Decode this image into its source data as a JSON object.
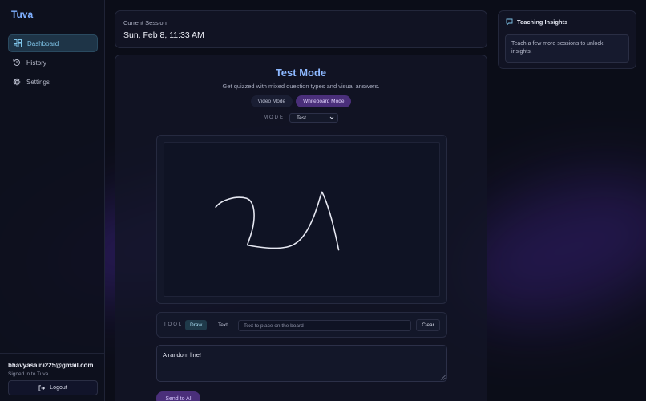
{
  "app": {
    "brand": "Tuva"
  },
  "sidebar": {
    "items": [
      {
        "label": "Dashboard",
        "icon": "dashboard-icon",
        "active": true
      },
      {
        "label": "History",
        "icon": "history-icon",
        "active": false
      },
      {
        "label": "Settings",
        "icon": "gear-icon",
        "active": false
      }
    ],
    "user": {
      "email": "bhavyasaini225@gmail.com",
      "status": "Signed in to Tuva"
    },
    "logout_label": "Logout"
  },
  "session": {
    "label": "Current Session",
    "value": "Sun, Feb 8, 11:33 AM"
  },
  "insights": {
    "title": "Teaching Insights",
    "message": "Teach a few more sessions to unlock insights."
  },
  "main": {
    "title": "Test Mode",
    "subtitle": "Get quizzed with mixed question types and visual answers.",
    "tabs": [
      {
        "label": "Video Mode",
        "active": false
      },
      {
        "label": "Whiteboard Mode",
        "active": true
      }
    ],
    "mode_label": "MODE",
    "mode_value": "Test"
  },
  "toolbar": {
    "label": "TOOL",
    "draw_label": "Draw",
    "text_label": "Text",
    "active_tool": "Draw",
    "text_placeholder": "Text to place on the board",
    "text_value": "",
    "clear_label": "Clear"
  },
  "answer": {
    "value": "A random line!"
  },
  "send_label": "Send to AI",
  "colors": {
    "accent_blue": "#8db8ff",
    "accent_purple": "#4a2f7a",
    "active_nav": "#1e3447",
    "background": "#0b0d18"
  }
}
